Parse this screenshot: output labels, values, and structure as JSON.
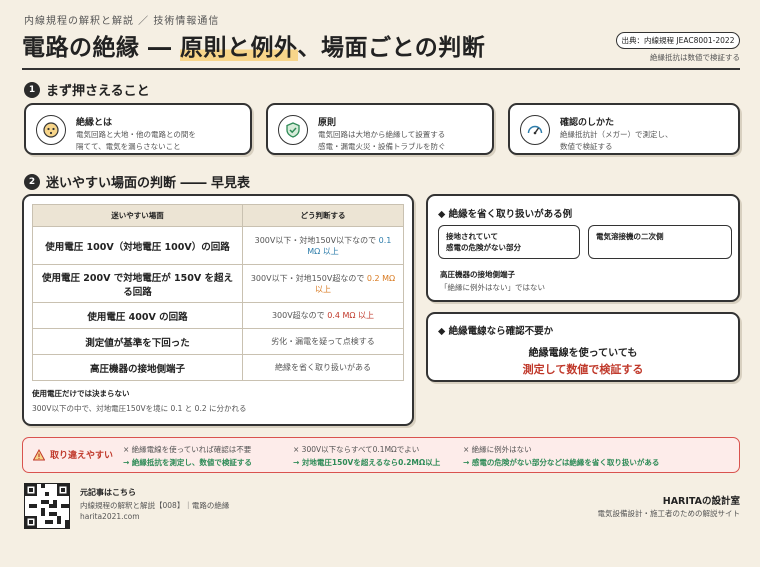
{
  "header": {
    "kicker": "内線規程の解釈と解説 ／ 技術情報通信",
    "title_pre": "電路の絶縁 ― ",
    "title_highlight": "原則と例外",
    "title_post": "、場面ごとの判断",
    "source_badge": "出典：内線規程 JEAC8001-2022",
    "source_note": "絶縁抵抗は数値で検証する"
  },
  "section1": {
    "number": "1",
    "title": "まず押さえること",
    "cards": [
      {
        "icon": "plug-icon",
        "title": "絶縁とは",
        "text": "電気回路と大地・他の電路との間を\n隔てて、電気を漏らさないこと"
      },
      {
        "icon": "shield-check-icon",
        "title": "原則",
        "text": "電気回路は大地から絶縁して設置する\n感電・漏電火災・設備トラブルを防ぐ"
      },
      {
        "icon": "gauge-icon",
        "title": "確認のしかた",
        "text": "絶縁抵抗計（メガー）で測定し、\n数値で検証する"
      }
    ]
  },
  "section2": {
    "number": "2",
    "title": "迷いやすい場面の判断 ―― 早見表",
    "table": {
      "headers": [
        "迷いやすい場面",
        "どう判断する"
      ],
      "rows": [
        {
          "scene": "使用電圧 100V（対地電圧 100V）の回路",
          "judge_pre": "300V以下・対地150V以下なので ",
          "judge_value": "0.1 MΩ 以上",
          "color": "blue"
        },
        {
          "scene": "使用電圧 200V で対地電圧が 150V を超える回路",
          "judge_pre": "300V以下・対地150V超なので ",
          "judge_value": "0.2 MΩ 以上",
          "color": "orange"
        },
        {
          "scene": "使用電圧 400V の回路",
          "judge_pre": "300V超なので ",
          "judge_value": "0.4 MΩ 以上",
          "color": "red"
        },
        {
          "scene": "測定値が基準を下回った",
          "judge_pre": "劣化・漏電を疑って点検する",
          "judge_value": "",
          "color": "none"
        },
        {
          "scene": "高圧機器の接地側端子",
          "judge_pre": "絶縁を省く取り扱いがある",
          "judge_value": "",
          "color": "none"
        }
      ],
      "note_title": "使用電圧だけでは決まらない",
      "note_text": "300V以下の中で、対地電圧150Vを境に 0.1 と 0.2 に分かれる"
    },
    "exceptions": {
      "title": "絶縁を省く取り扱いがある例",
      "item1": "接地されていて\n感電の危険がない部分",
      "item2": "電気溶接機の二次側",
      "item3_title": "高圧機器の接地側端子",
      "item3_text": "「絶縁に例外はない」ではない"
    },
    "insulated_wire": {
      "title": "絶縁電線なら確認不要か",
      "line1": "絶縁電線を使っていても",
      "line2": "測定して数値で検証する"
    }
  },
  "pitfalls": {
    "label": "取り違えやすい",
    "items": [
      {
        "wrong": "絶縁電線を使っていれば確認は不要",
        "right": "→ 絶縁抵抗を測定し、数値で検証する"
      },
      {
        "wrong": "300V以下ならすべて0.1MΩでよい",
        "right": "→ 対地電圧150Vを超えるなら0.2MΩ以上"
      },
      {
        "wrong": "絶縁に例外はない",
        "right": "→ 感電の危険がない部分などは絶縁を省く取り扱いがある"
      }
    ]
  },
  "footer": {
    "title": "元記事はこちら",
    "sub": "内線規程の解釈と解説【008】｜電路の絶縁",
    "url": "harita2021.com",
    "brand": "HARITAの設計室",
    "brand_sub": "電気設備設計・施工者のための解説サイト"
  },
  "colors": {
    "blue": "#2e7dab",
    "orange": "#d97a20",
    "red": "#c0392b",
    "green": "#2e8b57"
  }
}
